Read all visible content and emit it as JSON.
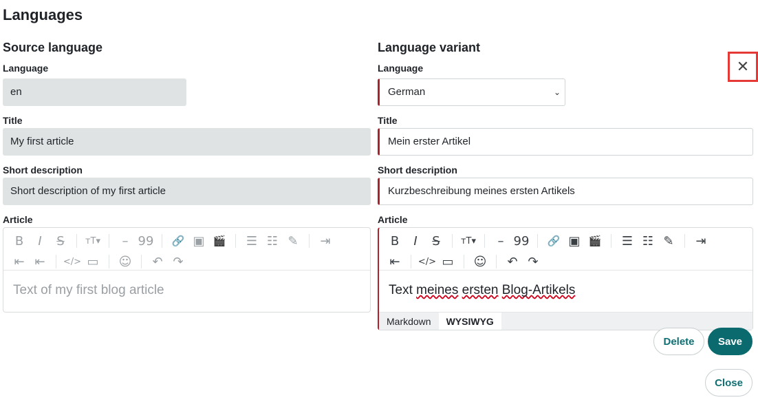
{
  "page": {
    "title": "Languages"
  },
  "source": {
    "section_title": "Source language",
    "language_label": "Language",
    "language_value": "en",
    "title_label": "Title",
    "title_value": "My first article",
    "short_label": "Short description",
    "short_value": "Short description of my first article",
    "article_label": "Article",
    "article_placeholder": "Text of my first blog article"
  },
  "variant": {
    "section_title": "Language variant",
    "language_label": "Language",
    "language_value": "German",
    "title_label": "Title",
    "title_value": "Mein erster Artikel",
    "short_label": "Short description",
    "short_value": "Kurzbeschreibung meines ersten Artikels",
    "article_label": "Article",
    "article_text_pre": "Text ",
    "article_text_w1": "meines",
    "article_text_mid1": " ",
    "article_text_w2": "ersten",
    "article_text_mid2": " ",
    "article_text_w3": "Blog-Artikels",
    "mode_tabs": [
      "Markdown",
      "WYSIWYG"
    ],
    "mode_selected": "WYSIWYG"
  },
  "toolbar": {
    "bold": "B",
    "italic": "I",
    "strike": "S",
    "heading": "тT▾",
    "hr": "–",
    "quote": "99",
    "link": "🔗",
    "image": "▣",
    "video": "🎬",
    "ul": "☰",
    "ol": "☷",
    "task": "✎",
    "indent": "⇥",
    "outdent": "⇤",
    "code": "</>",
    "codeblock": "▭",
    "emoji": "☺",
    "undo": "↶",
    "redo": "↷"
  },
  "actions": {
    "delete_label": "Delete",
    "save_label": "Save",
    "close_label": "Close",
    "close_icon": "✕"
  },
  "colors": {
    "accent": "#0b6a6e",
    "error": "#a8232a",
    "highlight": "#e53935"
  }
}
